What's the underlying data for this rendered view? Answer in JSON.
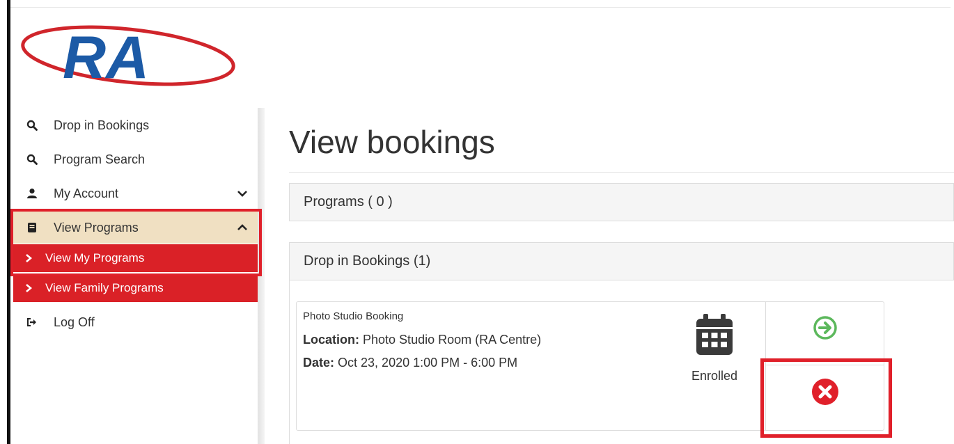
{
  "brand": {
    "logo_text": "RA",
    "colors": {
      "primary_blue": "#1c5aa6",
      "ring_red": "#d0252b"
    }
  },
  "sidebar": {
    "items": [
      {
        "label": "Drop in Bookings",
        "icon": "search-icon"
      },
      {
        "label": "Program Search",
        "icon": "search-icon"
      },
      {
        "label": "My Account",
        "icon": "user-icon",
        "chevron": "chevron-down-icon"
      },
      {
        "label": "View Programs",
        "icon": "book-icon",
        "chevron": "chevron-up-icon",
        "active": true
      },
      {
        "label": "Log Off",
        "icon": "sign-out-icon"
      }
    ],
    "subitems": [
      {
        "label": "View My Programs",
        "icon": "chevron-right-icon"
      },
      {
        "label": "View Family Programs",
        "icon": "chevron-right-icon"
      }
    ],
    "colors": {
      "active_bg": "#f0e0c2",
      "sub_bg": "#da2127"
    }
  },
  "main": {
    "title": "View bookings",
    "panels": [
      {
        "label": "Programs ( 0 )"
      },
      {
        "label": "Drop in Bookings (1)"
      }
    ],
    "booking": {
      "title": "Photo Studio Booking",
      "location_label": "Location:",
      "location_value": "Photo Studio Room (RA Centre)",
      "date_label": "Date:",
      "date_value": "Oct 23, 2020 1:00 PM - 6:00 PM",
      "status": "Enrolled",
      "status_icon": "calendar-icon",
      "go_icon": "arrow-circle-right-icon",
      "cancel_icon": "times-circle-icon",
      "colors": {
        "go": "#5cb85c",
        "cancel": "#e0202a"
      }
    }
  },
  "highlight_color": "#e0202a"
}
